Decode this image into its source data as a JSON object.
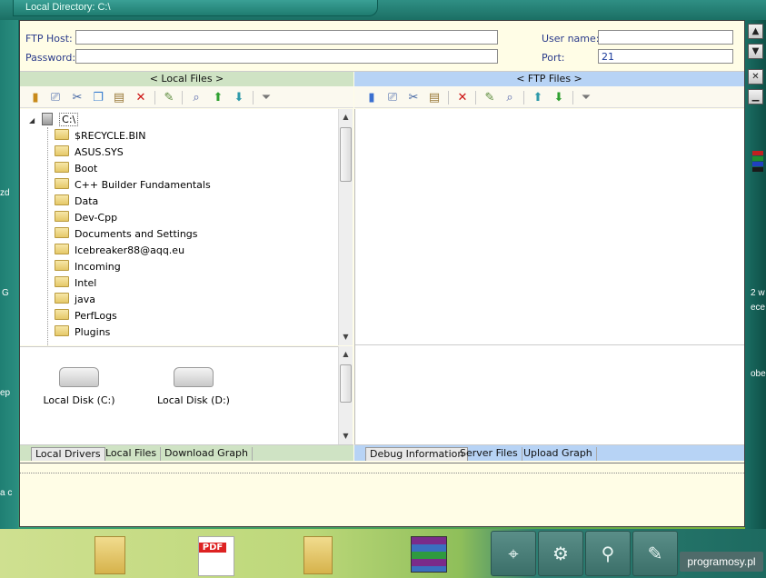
{
  "window": {
    "title": "Local Directory: C:\\"
  },
  "connection": {
    "host_label": "FTP Host:",
    "host_value": "",
    "password_label": "Password:",
    "password_value": "",
    "user_label": "User name:",
    "user_value": "",
    "port_label": "Port:",
    "port_value": "21"
  },
  "local_pane": {
    "header": "< Local Files >",
    "toolbar": [
      "bookmark-icon",
      "connect-icon",
      "cut-icon",
      "copy-icon",
      "paste-icon",
      "delete-icon",
      "edit-icon",
      "find-icon",
      "up-arrow-icon",
      "down-arrow-icon",
      "filter-icon"
    ],
    "tree_root": "C:\\",
    "tree_items": [
      "$RECYCLE.BIN",
      "ASUS.SYS",
      "Boot",
      "C++ Builder Fundamentals",
      "Data",
      "Dev-Cpp",
      "Documents and Settings",
      "Icebreaker88@aqq.eu",
      "Incoming",
      "Intel",
      "java",
      "PerfLogs",
      "Plugins"
    ],
    "drives": [
      "Local Disk (C:)",
      "Local Disk (D:)"
    ],
    "tabs": [
      "Local Drivers",
      "Local Files",
      "Download Graph"
    ],
    "active_tab": "Local Drivers"
  },
  "ftp_pane": {
    "header": "< FTP Files >",
    "tabs": [
      "Debug Information",
      "Server Files",
      "Upload Graph"
    ],
    "active_tab": "Debug Information"
  },
  "colors": {
    "accent_blue": "#b7d3f5",
    "accent_green": "#cfe3c4",
    "panel_bg": "#fffde6",
    "label_blue": "#2a3a8a",
    "delete_red": "#cc1111"
  },
  "desktop": {
    "side_text": [
      "zd",
      "G",
      "ep",
      "2 w",
      "ece",
      "obe",
      "a c"
    ],
    "dock_icons": [
      "network-icon",
      "settings-gear-icon",
      "binoculars-icon",
      "tools-icon",
      "terminal-icon"
    ],
    "taskbar_icons": [
      "folder-icon",
      "pdf-icon",
      "folder-icon",
      "archive-icon"
    ],
    "watermark": "programosy.pl"
  }
}
